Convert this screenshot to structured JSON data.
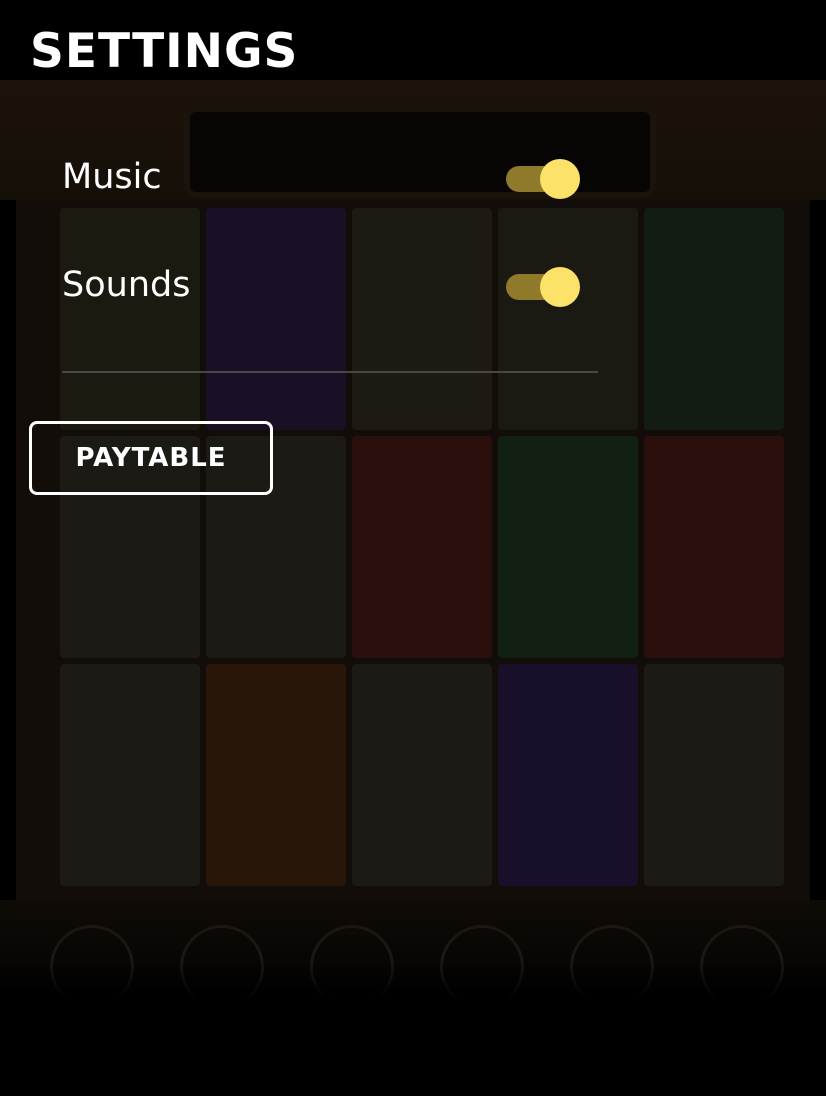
{
  "settings": {
    "title": "SETTINGS",
    "music": {
      "label": "Music",
      "enabled": true
    },
    "sounds": {
      "label": "Sounds",
      "enabled": true
    },
    "paytable_label": "PAYTABLE"
  },
  "colors": {
    "toggle_track_on": "#8f7a2b",
    "toggle_knob_on": "#fde26a",
    "background": "#000000",
    "text": "#ffffff"
  }
}
